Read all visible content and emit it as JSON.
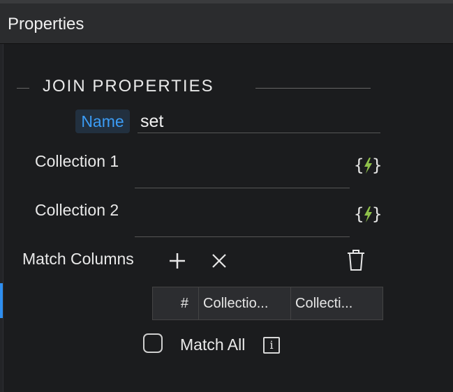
{
  "panel": {
    "title": "Properties"
  },
  "section": {
    "title": "JOIN PROPERTIES"
  },
  "name_field": {
    "label": "Name",
    "value": "set"
  },
  "collection1": {
    "label": "Collection 1",
    "value": ""
  },
  "collection2": {
    "label": "Collection 2",
    "value": ""
  },
  "match_columns": {
    "label": "Match Columns",
    "add_icon": "plus-icon",
    "remove_icon": "close-icon",
    "delete_icon": "trash-icon"
  },
  "grid": {
    "columns": [
      "#",
      "Collectio...",
      "Collecti..."
    ]
  },
  "match_all": {
    "label": "Match All",
    "checked": false,
    "info_icon": "info-icon"
  },
  "colors": {
    "accent": "#2e8ef0",
    "dynamic_icon": "#8fc14a",
    "background": "#1b1c1e"
  }
}
